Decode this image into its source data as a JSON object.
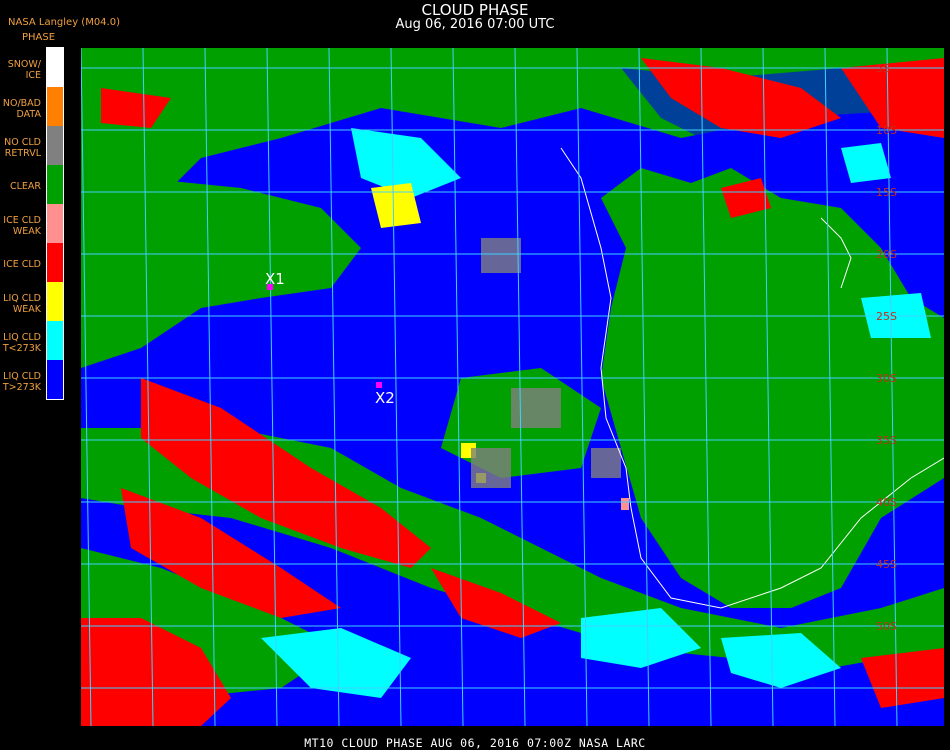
{
  "header": {
    "title": "CLOUD PHASE",
    "datetime": "Aug 06, 2016 07:00 UTC",
    "credit": "NASA Langley (M04.0)"
  },
  "legend": {
    "title": "PHASE",
    "items": [
      {
        "line1": "SNOW/",
        "line2": "ICE",
        "color": "#ffffff"
      },
      {
        "line1": "NO/BAD",
        "line2": "DATA",
        "color": "#ff8000"
      },
      {
        "line1": "NO CLD",
        "line2": "RETRVL",
        "color": "#808080"
      },
      {
        "line1": "CLEAR",
        "line2": "",
        "color": "#00a000"
      },
      {
        "line1": "ICE CLD",
        "line2": "WEAK",
        "color": "#ff9090"
      },
      {
        "line1": "ICE CLD",
        "line2": "",
        "color": "#ff0000"
      },
      {
        "line1": "LIQ CLD",
        "line2": "WEAK",
        "color": "#ffff00"
      },
      {
        "line1": "LIQ CLD",
        "line2": "T<273K",
        "color": "#00ffff"
      },
      {
        "line1": "LIQ CLD",
        "line2": "T>273K",
        "color": "#0000ff"
      }
    ]
  },
  "markers": [
    {
      "label": "X1",
      "color": "#ff00ff"
    },
    {
      "label": "X2",
      "color": "#ff00ff"
    }
  ],
  "grid_labels": [
    "5S",
    "10S",
    "15S",
    "20S",
    "25S",
    "30S",
    "35S",
    "40S",
    "45S",
    "50S"
  ],
  "footer": "MT10   CLOUD PHASE   AUG 06, 2016 07:00Z   NASA LARC"
}
